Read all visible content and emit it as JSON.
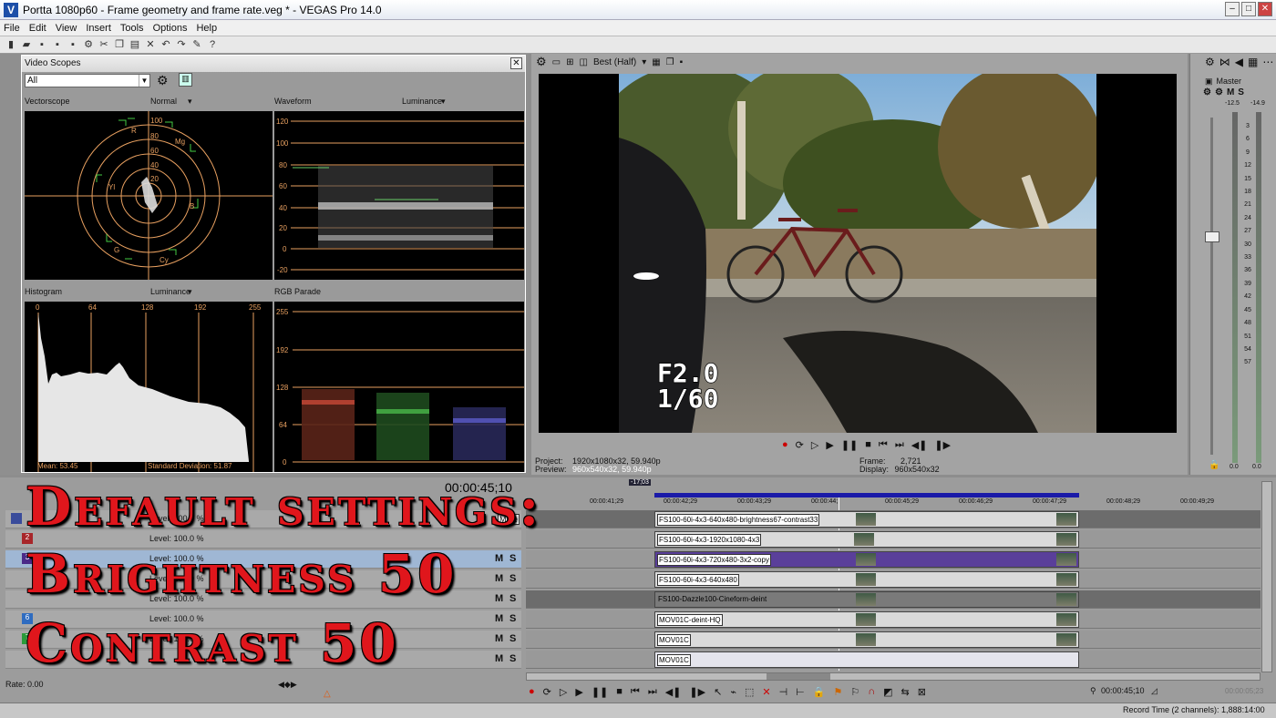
{
  "window": {
    "title": "Portta 1080p60 - Frame geometry and frame rate.veg * - VEGAS Pro 14.0",
    "logo": "V"
  },
  "menu": [
    "File",
    "Edit",
    "View",
    "Insert",
    "Tools",
    "Options",
    "Help"
  ],
  "scopes": {
    "title": "Video Scopes",
    "select": "All",
    "vectorscope": {
      "label": "Vectorscope",
      "mode": "Normal",
      "ticks": [
        "100",
        "80",
        "60",
        "40",
        "20"
      ],
      "targets": [
        "R",
        "Mg",
        "B",
        "Cy",
        "G",
        "Yl"
      ]
    },
    "waveform": {
      "label": "Waveform",
      "mode": "Luminance",
      "ticks": [
        "120",
        "100",
        "80",
        "60",
        "40",
        "20",
        "0",
        "-20"
      ]
    },
    "histogram": {
      "label": "Histogram",
      "mode": "Luminance",
      "ticks": [
        "0",
        "64",
        "128",
        "192",
        "255"
      ],
      "mean": "Mean: 53.45",
      "stddev": "Standard Deviation: 51.87"
    },
    "parade": {
      "label": "RGB Parade",
      "ticks": [
        "255",
        "192",
        "128",
        "64",
        "0"
      ]
    }
  },
  "preview": {
    "quality": "Best (Half)",
    "overlay_line1": "F2.0",
    "overlay_line2": "1/60",
    "project_label": "Project:",
    "project_value": "1920x1080x32, 59.940p",
    "preview_label": "Preview:",
    "preview_value": "960x540x32, 59.940p",
    "frame_label": "Frame:",
    "frame_value": "2,721",
    "display_label": "Display:",
    "display_value": "960x540x32"
  },
  "mixer": {
    "label": "Master",
    "val_left": "-12.5",
    "val_right": "-14.9",
    "scale": [
      "3",
      "6",
      "9",
      "12",
      "15",
      "18",
      "21",
      "24",
      "27",
      "30",
      "33",
      "36",
      "39",
      "42",
      "45",
      "48",
      "51",
      "54",
      "57"
    ],
    "bottom_left": "0.0",
    "bottom_right": "0.0"
  },
  "timeline": {
    "timecode": "00:00:45;10",
    "cursor_flag": "-17;03",
    "ruler": [
      "00:00:41;29",
      "00:00:42;29",
      "00:00:43;29",
      "00:00:44;",
      "00:00:45;29",
      "00:00:46;29",
      "00:00:47;29",
      "00:00:48;29",
      "00:00:49;29"
    ],
    "tooltip": "Mute",
    "tracks": [
      {
        "num": "1",
        "level": "Level: 100.0 %",
        "clip": "FS100-60i-4x3-640x480-brightness67-contrast33",
        "color": "#3a4c9b"
      },
      {
        "num": "2",
        "level": "Level: 100.0 %",
        "clip": "FS100-60i-4x3-1920x1080-4x3",
        "color": "#a8262a"
      },
      {
        "num": "3",
        "level": "Level: 100.0 %",
        "clip": "FS100-60i-4x3-720x480-3x2-copy",
        "color": "#4b2a88"
      },
      {
        "num": "4",
        "level": "Level: 100.0 %",
        "clip": "FS100-60i-4x3-640x480",
        "color": "#2d5aa0"
      },
      {
        "num": "5",
        "level": "Level: 100.0 %",
        "clip": "FS100-Dazzle100-Cineform-deint",
        "color": "#1b8a6e"
      },
      {
        "num": "6",
        "level": "Level: 100.0 %",
        "clip": "MOV01C-deint-HQ",
        "color": "#2f6cc0"
      },
      {
        "num": "7",
        "level": "Level: 100.0 %",
        "clip": "MOV01C",
        "color": "#2a9a3a"
      },
      {
        "num": "8",
        "level": "",
        "clip": "MOV01C",
        "color": "#3a6aa0"
      }
    ],
    "rate": "Rate: 0.00",
    "end_timecode": "00:00:45;10",
    "end_timecode2": "00:00:05;23",
    "record_time": "Record Time (2 channels): 1,888:14:00"
  },
  "overlay": {
    "line1": "Default settings:",
    "line2": "Brightness 50",
    "line3": "Contrast 50"
  },
  "colors": {
    "accent": "#e0161c",
    "titlebar": "#e6ebf3",
    "scope_line": "#e8a060"
  }
}
